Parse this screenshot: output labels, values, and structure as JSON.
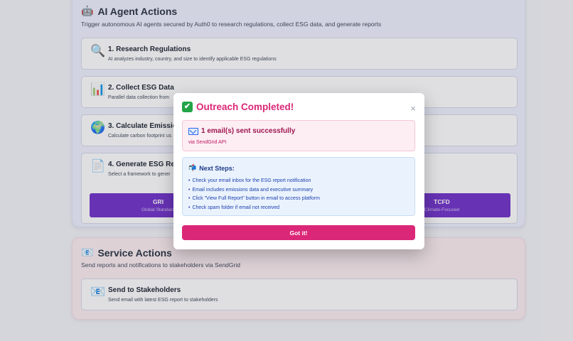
{
  "ai_section": {
    "icon": "robot-icon",
    "title": "AI Agent Actions",
    "description": "Trigger autonomous AI agents secured by Auth0 to research regulations, collect ESG data, and generate reports",
    "actions": [
      {
        "icon": "magnifier-icon",
        "title": "1. Research Regulations",
        "description": "AI analyzes industry, country, and size to identify applicable ESG regulations"
      },
      {
        "icon": "bar-chart-icon",
        "title": "2. Collect ESG Data",
        "description": "Parallel data collection from"
      },
      {
        "icon": "globe-icon",
        "title": "3. Calculate Emissio",
        "description": "Calculate carbon footprint us"
      },
      {
        "icon": "document-icon",
        "title": "4. Generate ESG Rep",
        "description": "Select a framework to gener"
      }
    ],
    "frameworks": [
      {
        "name": "GRI",
        "subtitle": "Global Standard"
      },
      {
        "name": "TCFD",
        "subtitle": "Climate-Focused"
      }
    ]
  },
  "service_section": {
    "icon": "envelope-icon",
    "title": "Service Actions",
    "description": "Send reports and notifications to stakeholders via SendGrid",
    "actions": [
      {
        "icon": "envelope-icon",
        "title": "Send to Stakeholders",
        "description": "Send email with latest ESG report to stakeholders"
      }
    ]
  },
  "modal": {
    "title": "Outreach Completed!",
    "close_label": "×",
    "success": {
      "title": "1 email(s) sent successfully",
      "subtitle": "via SendGrid API"
    },
    "next_steps": {
      "title": "Next Steps:",
      "items": [
        "Check your email inbox for the ESG report notification",
        "Email includes emissions data and executive summary",
        "Click \"View Full Report\" button in email to access platform",
        "Check spam folder if email not received"
      ]
    },
    "button_label": "Got it!"
  },
  "colors": {
    "accent_pink": "#db2777",
    "framework_purple": "#6a27c7",
    "success_green": "#22a447"
  }
}
